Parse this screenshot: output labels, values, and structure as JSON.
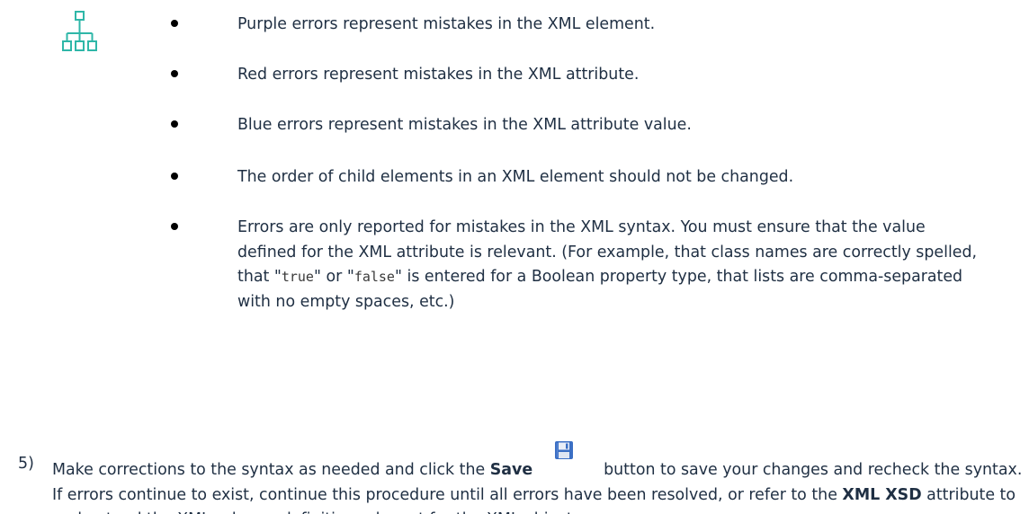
{
  "bullets": [
    {
      "text": "Purple errors represent mistakes in the XML element."
    },
    {
      "text": "Red errors represent mistakes in the XML attribute."
    },
    {
      "text": "Blue errors represent mistakes in the XML attribute value."
    },
    {
      "text": "The order of child elements in an XML element should not be changed."
    },
    {
      "text_before": "Errors are only reported for mistakes in the XML syntax. You must ensure that the value defined for the XML attribute is relevant. (For example, that class names are correctly spelled, that \"",
      "code_true": "true",
      "text_mid": "\" or \"",
      "code_false": "false",
      "text_after": "\" is entered for a Boolean property type, that lists are comma-separated with no empty spaces, etc.)"
    }
  ],
  "step": {
    "number": "5)",
    "text_1": "Make corrections to the syntax as needed and click the ",
    "save_label": "Save",
    "text_2": "button to save your changes and recheck the syntax. If errors continue to exist, continue this procedure until all errors have been resolved, or refer to the ",
    "xsd_label": "XML XSD",
    "text_3": " attribute to understand the XML schema definition relevant for the XML object."
  },
  "icons": {
    "tree": "hierarchy-tree-icon",
    "save": "floppy-disk-icon"
  },
  "colors": {
    "text": "#1f2f43",
    "tree_icon": "#2fb7a8",
    "save_icon": "#3b6fc4"
  }
}
